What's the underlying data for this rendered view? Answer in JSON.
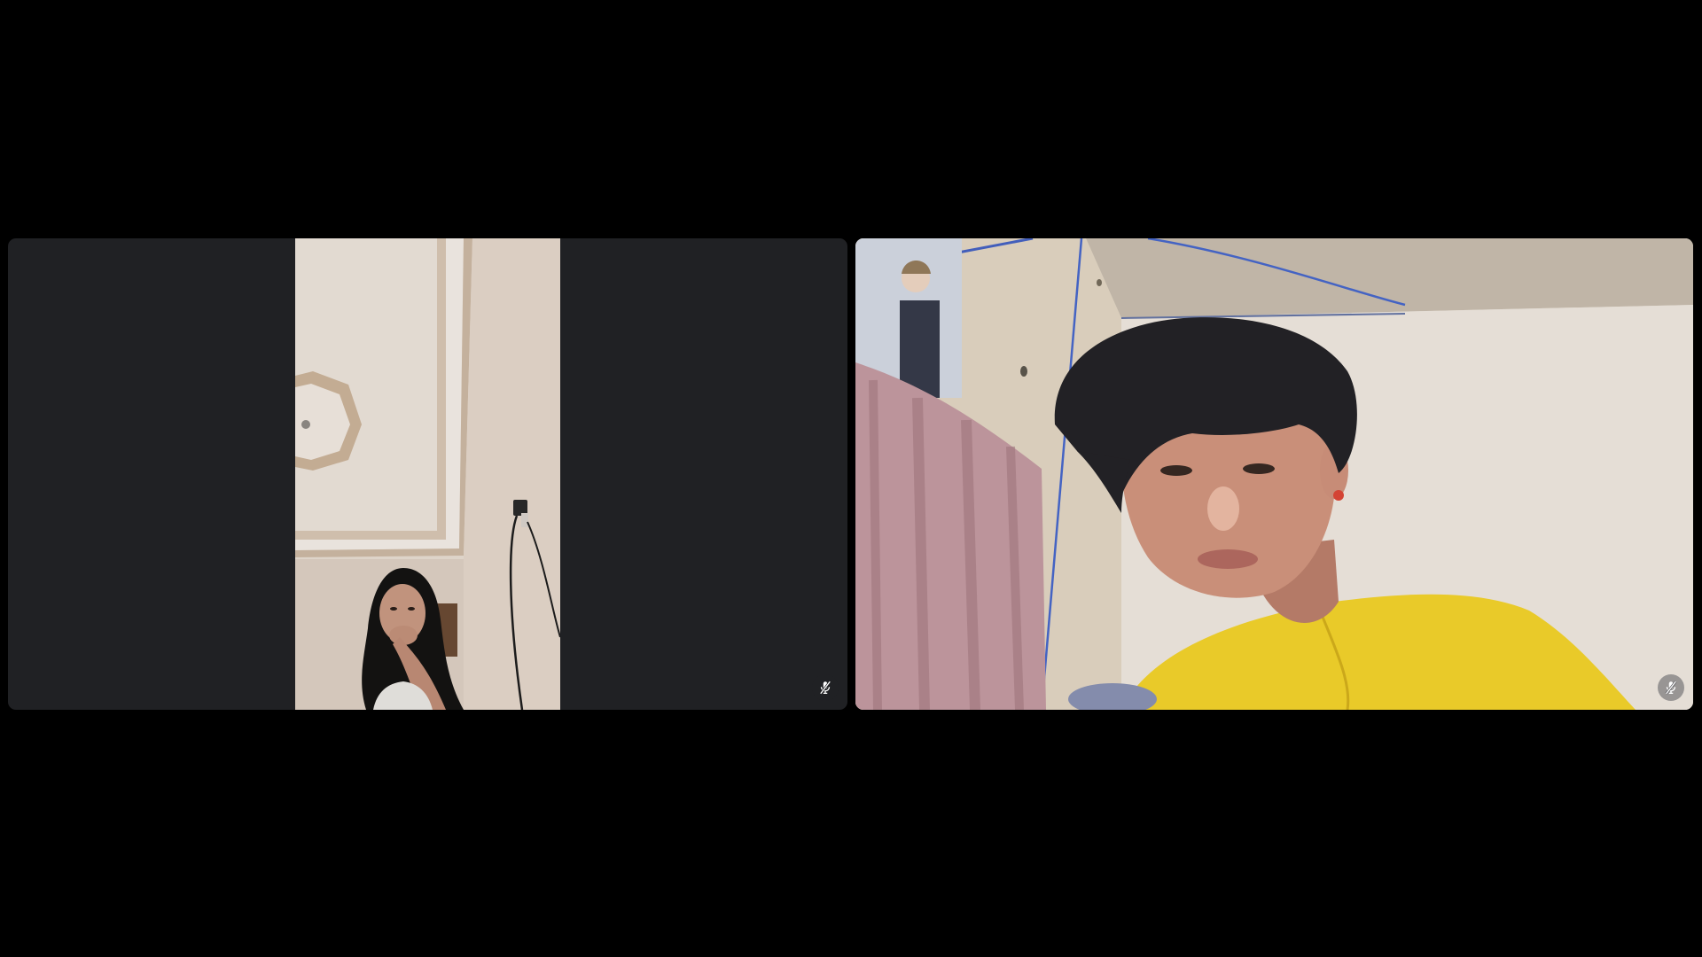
{
  "meeting": {
    "participants": [
      {
        "id": "participant-1",
        "feed_orientation": "portrait",
        "mic_state": "muted",
        "mic_icon": "mic-off-icon"
      },
      {
        "id": "participant-2",
        "feed_orientation": "landscape",
        "mic_state": "muted",
        "mic_icon": "mic-off-icon"
      }
    ]
  },
  "colors": {
    "page_background": "#000000",
    "tile_background": "#202124",
    "icon_color": "#ffffff"
  }
}
